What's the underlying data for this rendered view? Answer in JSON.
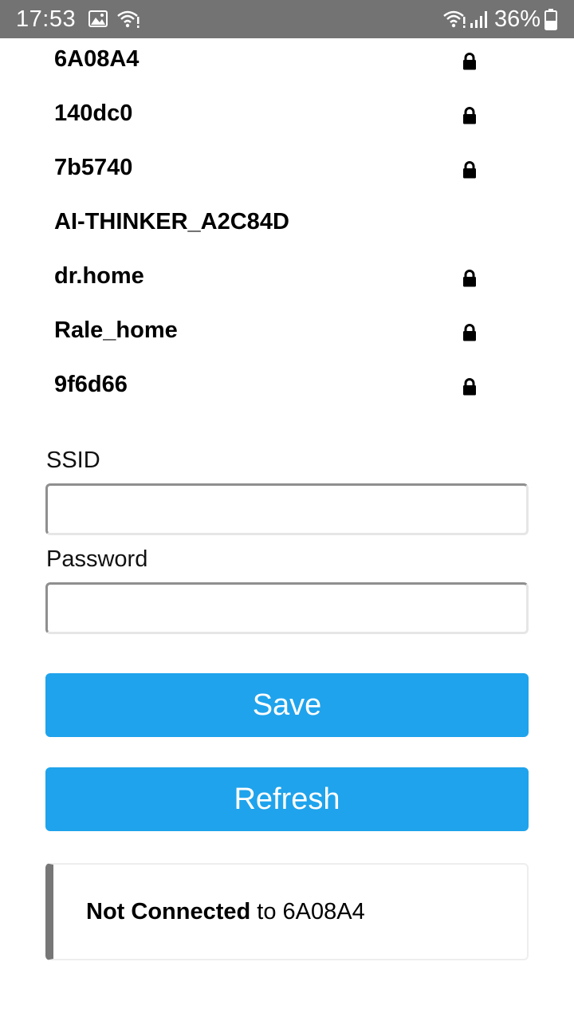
{
  "status_bar": {
    "time": "17:53",
    "battery_percent": "36%",
    "icons": [
      "gallery-icon",
      "wifi-icon",
      "wifi-icon",
      "signal-icon",
      "battery-icon"
    ]
  },
  "networks": [
    {
      "ssid": "6A08A4",
      "secured": true
    },
    {
      "ssid": "140dc0",
      "secured": true
    },
    {
      "ssid": "7b5740",
      "secured": true
    },
    {
      "ssid": "AI-THINKER_A2C84D",
      "secured": false
    },
    {
      "ssid": "dr.home",
      "secured": true
    },
    {
      "ssid": "Rale_home",
      "secured": true
    },
    {
      "ssid": "9f6d66",
      "secured": true
    }
  ],
  "form": {
    "ssid_label": "SSID",
    "ssid_value": "",
    "password_label": "Password",
    "password_value": ""
  },
  "buttons": {
    "save": "Save",
    "refresh": "Refresh"
  },
  "status_message": {
    "bold": "Not Connected",
    "rest": " to 6A08A4"
  },
  "colors": {
    "status_bar": "#737373",
    "button": "#1fa3ec",
    "message_accent": "#777777"
  }
}
